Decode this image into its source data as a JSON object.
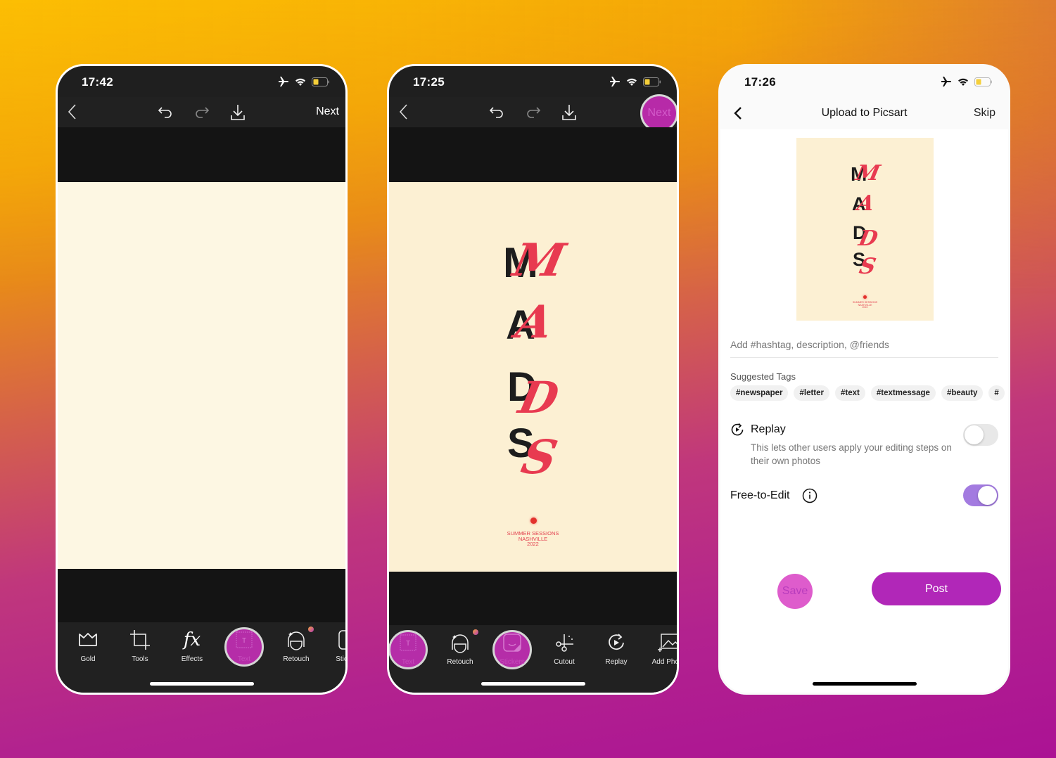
{
  "colors": {
    "accent_magenta": "#b127b8",
    "poster_red": "#e83a50",
    "poster_black": "#1d1d1d",
    "poster_bg": "#fcf0d3",
    "toggle_on": "#a37be0"
  },
  "phones": [
    {
      "status": {
        "time": "17:42",
        "icons": [
          "airplane-icon",
          "wifi-icon",
          "battery-low-icon"
        ]
      },
      "toolbar": {
        "back": "back-icon",
        "undo": "undo-icon",
        "redo": "redo-icon",
        "download": "download-icon",
        "next_label": "Next"
      },
      "tools": [
        {
          "label": "Gold",
          "icon": "crown-icon"
        },
        {
          "label": "Tools",
          "icon": "crop-icon"
        },
        {
          "label": "Effects",
          "icon": "fx-icon"
        },
        {
          "label": "Text",
          "icon": "text-icon",
          "active": true
        },
        {
          "label": "Retouch",
          "icon": "retouch-face-icon",
          "badge": true
        },
        {
          "label": "Stickers",
          "icon": "sticker-icon"
        }
      ]
    },
    {
      "status": {
        "time": "17:25",
        "icons": [
          "airplane-icon",
          "wifi-icon",
          "battery-low-icon"
        ]
      },
      "toolbar": {
        "back": "back-icon",
        "undo": "undo-icon",
        "redo": "redo-icon",
        "download": "download-icon",
        "next_label": "Next",
        "next_highlighted": true
      },
      "poster": {
        "letters": [
          "M",
          "A",
          "D",
          "S"
        ],
        "caption_lines": [
          "SUMMER SESSIONS",
          "NASHVILLE",
          "2022"
        ]
      },
      "tools": [
        {
          "label": "Text",
          "icon": "text-icon",
          "active": true
        },
        {
          "label": "Retouch",
          "icon": "retouch-face-icon",
          "badge": true
        },
        {
          "label": "Stickers",
          "icon": "sticker-icon",
          "active": true
        },
        {
          "label": "Cutout",
          "icon": "scissors-icon"
        },
        {
          "label": "Replay",
          "icon": "replay-icon"
        },
        {
          "label": "Add Photo",
          "icon": "add-photo-icon"
        }
      ]
    },
    {
      "status": {
        "time": "17:26",
        "icons": [
          "airplane-icon",
          "wifi-icon",
          "battery-low-icon"
        ]
      },
      "header": {
        "title": "Upload to Picsart",
        "skip_label": "Skip"
      },
      "poster": {
        "letters": [
          "M",
          "A",
          "D",
          "S"
        ],
        "caption_lines": [
          "SUMMER SESSIONS",
          "NASHVILLE",
          "2022"
        ]
      },
      "description": {
        "placeholder": "Add #hashtag, description, @friends",
        "value": ""
      },
      "suggested_tags": {
        "label": "Suggested Tags",
        "tags": [
          "#newspaper",
          "#letter",
          "#text",
          "#textmessage",
          "#beauty",
          "#"
        ]
      },
      "replay": {
        "title": "Replay",
        "description": "This lets other users apply your editing steps on their own photos",
        "enabled": false
      },
      "free_to_edit": {
        "label": "Free-to-Edit",
        "enabled": true
      },
      "actions": {
        "save_label": "Save",
        "post_label": "Post"
      }
    }
  ]
}
